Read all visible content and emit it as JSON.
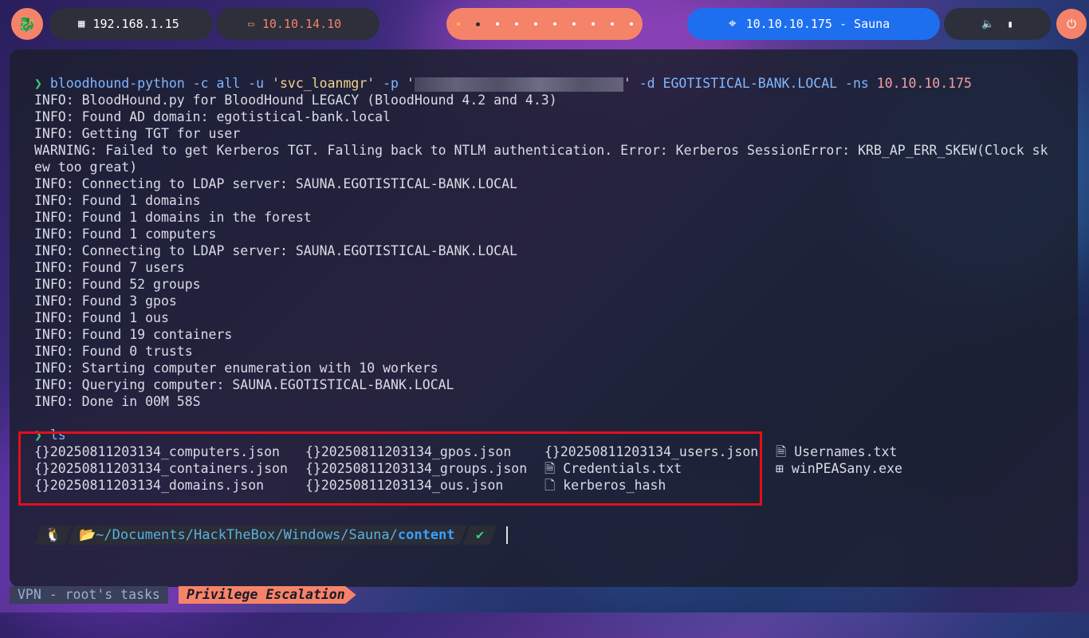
{
  "topbar": {
    "host_ip": "192.168.1.15",
    "vpn_ip": "10.10.14.10",
    "target": "10.10.10.175 - Sauna",
    "workspaces": [
      "1",
      "2",
      "3",
      "4",
      "5",
      "6",
      "7",
      "8",
      "9",
      "10"
    ],
    "accent_color": "#f5836a",
    "target_color": "#1e6ff0"
  },
  "terminal": {
    "command": {
      "prompt_symbol": "❯",
      "program": "bloodhound-python",
      "args_1": " -c all -u ",
      "user": "'svc_loanmgr'",
      "args_2": " -p ",
      "password_open": "'",
      "password_close": "'",
      "args_3": " -d EGOTISTICAL-BANK.LOCAL -ns ",
      "ip": "10.10.10.175"
    },
    "output": [
      "INFO: BloodHound.py for BloodHound LEGACY (BloodHound 4.2 and 4.3)",
      "INFO: Found AD domain: egotistical-bank.local",
      "INFO: Getting TGT for user",
      "WARNING: Failed to get Kerberos TGT. Falling back to NTLM authentication. Error: Kerberos SessionError: KRB_AP_ERR_SKEW(Clock sk",
      "ew too great)",
      "INFO: Connecting to LDAP server: SAUNA.EGOTISTICAL-BANK.LOCAL",
      "INFO: Found 1 domains",
      "INFO: Found 1 domains in the forest",
      "INFO: Found 1 computers",
      "INFO: Connecting to LDAP server: SAUNA.EGOTISTICAL-BANK.LOCAL",
      "INFO: Found 7 users",
      "INFO: Found 52 groups",
      "INFO: Found 3 gpos",
      "INFO: Found 1 ous",
      "INFO: Found 19 containers",
      "INFO: Found 0 trusts",
      "INFO: Starting computer enumeration with 10 workers",
      "INFO: Querying computer: SAUNA.EGOTISTICAL-BANK.LOCAL",
      "INFO: Done in 00M 58S"
    ],
    "ls_command": "ls",
    "files": [
      {
        "name": "20250811203134_computers.json",
        "icon": "json-icon"
      },
      {
        "name": "20250811203134_containers.json",
        "icon": "json-icon"
      },
      {
        "name": "20250811203134_domains.json",
        "icon": "json-icon"
      },
      {
        "name": "20250811203134_gpos.json",
        "icon": "json-icon"
      },
      {
        "name": "20250811203134_groups.json",
        "icon": "json-icon"
      },
      {
        "name": "20250811203134_ous.json",
        "icon": "json-icon"
      },
      {
        "name": "20250811203134_users.json",
        "icon": "json-icon"
      },
      {
        "name": "Credentials.txt",
        "icon": "text-file-icon"
      },
      {
        "name": "kerberos_hash",
        "icon": "file-icon"
      },
      {
        "name": "Usernames.txt",
        "icon": "text-file-icon"
      },
      {
        "name": "winPEASany.exe",
        "icon": "windows-icon"
      }
    ],
    "shell_prompt": {
      "path_prefix": "~/Documents/HackTheBox/Windows/Sauna/",
      "path_current": "content",
      "status": "✔"
    },
    "highlight_color": "#e0101a"
  },
  "statusbar": {
    "session": "VPN - root's tasks",
    "active_window": "Privilege Escalation"
  }
}
